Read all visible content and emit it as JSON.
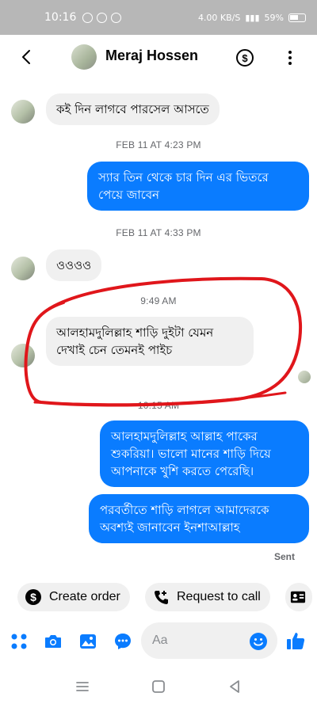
{
  "status_bar": {
    "time": "10:16",
    "speed": "4.00 KB/S",
    "battery": "59%"
  },
  "header": {
    "contact_name": "Meraj Hossen",
    "dollar_symbol": "$"
  },
  "messages": [
    {
      "side": "in",
      "text": "কই দিন লাগবে পারসেল আসতে"
    },
    {
      "type": "timestamp",
      "text": "FEB 11 AT 4:23 PM"
    },
    {
      "side": "out",
      "line1": "স্যার তিন থেকে চার দিন এর ভিতরে",
      "line2": "পেয়ে জাবেন"
    },
    {
      "type": "timestamp",
      "text": "FEB 11 AT 4:33 PM"
    },
    {
      "side": "in",
      "text": "ওওওও"
    },
    {
      "type": "timestamp",
      "text": "9:49 AM"
    },
    {
      "side": "in",
      "line1": "আলহামদুলিল্লাহ শাড়ি দুইটা যেমন",
      "line2": "দেখাই চেন তেমনই পাইচ"
    },
    {
      "type": "timestamp",
      "text": "10:15 AM"
    },
    {
      "side": "out",
      "line1": "আলহামদুলিল্লাহ আল্লাহ পাকের",
      "line2": "শুকরিয়া। ভালো মানের শাড়ি দিয়ে",
      "line3": "আপনাকে খুশি করতে পেরেছি।"
    },
    {
      "side": "out",
      "line1": "পরবর্তীতে শাড়ি লাগলে আমাদেরকে",
      "line2": "অবশ্যই জানাবেন ইনশাআল্লাহ"
    }
  ],
  "delivery_status": "Sent",
  "quick_actions": {
    "create_order": "Create order",
    "request_to_call": "Request to call"
  },
  "composer": {
    "placeholder": "Aa"
  },
  "colors": {
    "accent": "#0a7cff",
    "incoming_bubble": "#f0f0f0",
    "annotation": "#e0161b",
    "status_bar": "#b7b7b7"
  },
  "icons": [
    "back-arrow-icon",
    "dollar-icon",
    "more-icon",
    "apps-icon",
    "camera-icon",
    "gallery-icon",
    "chat-bubble-icon",
    "emoji-icon",
    "thumbs-up-icon",
    "dollar-circle-icon",
    "phone-plus-icon",
    "contact-card-icon"
  ]
}
